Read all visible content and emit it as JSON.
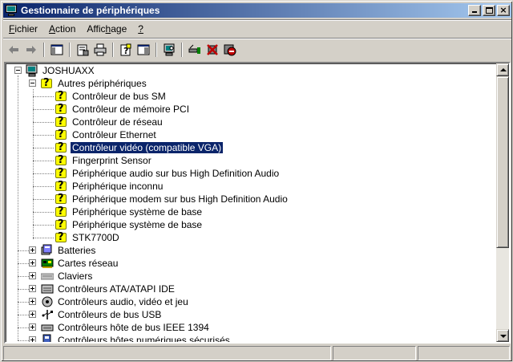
{
  "window": {
    "title": "Gestionnaire de périphériques"
  },
  "menu": [
    {
      "pre": "",
      "u": "F",
      "post": "ichier"
    },
    {
      "pre": "",
      "u": "A",
      "post": "ction"
    },
    {
      "pre": "Affic",
      "u": "h",
      "post": "age"
    },
    {
      "pre": "",
      "u": "?",
      "post": ""
    }
  ],
  "tree": {
    "root": "JOSHUAXX",
    "group_expanded": "Autres périphériques",
    "unknown_devices": [
      "Contrôleur de bus SM",
      "Contrôleur de mémoire PCI",
      "Contrôleur de réseau",
      "Contrôleur Ethernet",
      "Contrôleur vidéo (compatible VGA)",
      "Fingerprint Sensor",
      "Périphérique audio sur bus High Definition Audio",
      "Périphérique inconnu",
      "Périphérique modem sur bus High Definition Audio",
      "Périphérique système de base",
      "Périphérique système de base",
      "STK7700D"
    ],
    "selected_index": 4,
    "categories": [
      {
        "label": "Batteries",
        "icon": "battery-icon"
      },
      {
        "label": "Cartes réseau",
        "icon": "network-card-icon"
      },
      {
        "label": "Claviers",
        "icon": "keyboard-icon"
      },
      {
        "label": "Contrôleurs ATA/ATAPI IDE",
        "icon": "ide-controller-icon"
      },
      {
        "label": "Contrôleurs audio, vidéo et jeu",
        "icon": "audio-icon"
      },
      {
        "label": "Contrôleurs de bus USB",
        "icon": "usb-icon"
      },
      {
        "label": "Contrôleurs hôte de bus IEEE 1394",
        "icon": "firewire-icon"
      },
      {
        "label": "Contrôleurs hôtes numériques sécurisés",
        "icon": "sd-host-icon"
      }
    ]
  },
  "colors": {
    "title_start": "#0a246a",
    "title_end": "#a6caf0",
    "selection": "#0a246a",
    "warning": "#ffff00"
  }
}
